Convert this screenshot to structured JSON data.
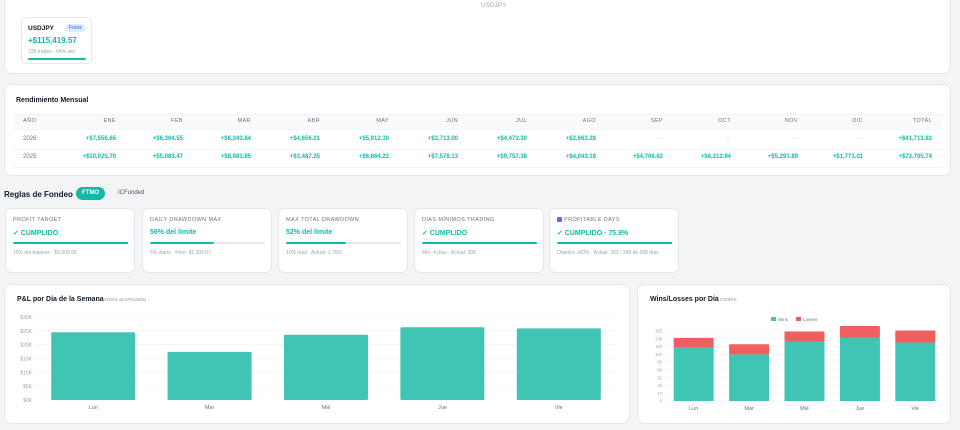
{
  "top": {
    "label": "USDJPY",
    "symbol": {
      "name": "USDJPY",
      "badge": "Forex",
      "value": "+$115,419.57",
      "sub": "729 trades · 64% win"
    }
  },
  "monthly": {
    "title": "Rendimiento Mensual",
    "headers": [
      "AÑO",
      "ENE",
      "FEB",
      "MAR",
      "ABR",
      "MAY",
      "JUN",
      "JUL",
      "AGO",
      "SEP",
      "OCT",
      "NOV",
      "DIC",
      "TOTAL"
    ],
    "rows": [
      {
        "year": "2026",
        "values": [
          "+$7,556.65",
          "+$6,304.55",
          "+$6,343.84",
          "+$4,656.01",
          "+$5,912.30",
          "+$3,713.00",
          "+$4,473.30",
          "+$2,663.28",
          "—",
          "—",
          "—",
          "—",
          "+$41,713.83"
        ]
      },
      {
        "year": "2025",
        "values": [
          "+$10,025.70",
          "+$5,083.47",
          "+$8,983.95",
          "+$3,487.25",
          "+$6,664.22",
          "+$7,578.13",
          "+$9,757.38",
          "+$4,043.18",
          "+$4,706.62",
          "+$6,312.94",
          "+$5,291.89",
          "+$1,771.01",
          "+$73,705.74"
        ]
      }
    ]
  },
  "reglas": {
    "title": "Reglas de Fondeo",
    "tabs": [
      "FTMO",
      "ICFunded"
    ],
    "cards": [
      {
        "title": "PROFIT TARGET",
        "status": "✓ CUMPLIDO",
        "progress": 100,
        "detail": "10% del balance · $5,000.00"
      },
      {
        "title": "DAILY DRAWDOWN MAX",
        "status": "56% del límite",
        "progress": 56,
        "detail": "5% diario · Peor: $1,393.67"
      },
      {
        "title": "MAX TOTAL DRAWDOWN",
        "status": "52% del límite",
        "progress": 52,
        "detail": "10% total · Actual: 1.76%"
      },
      {
        "title": "DÍAS MÍNIMOS TRADING",
        "status": "✓ CUMPLIDO",
        "progress": 100,
        "detail": "Mín. 4 días · Actual: 398"
      },
      {
        "title": "PROFITABLE DAYS",
        "status": "✓ CUMPLIDO · 75.9%",
        "progress": 100,
        "detail": "Objetivo ≥60% · Actual: 302 / 398 de 398 días"
      }
    ]
  },
  "pnl_chart": {
    "title": "P&L por Día de la Semana",
    "subtitle": "suma acumulada"
  },
  "wl_chart": {
    "title": "Wins/Losses por Día",
    "subtitle": "conteo"
  },
  "colors": {
    "accent": "#14b8a6",
    "bar": "#40c4b4",
    "loss": "#ef5f5f"
  },
  "chart_data": [
    {
      "type": "bar",
      "title": "P&L por Día de la Semana",
      "categories": [
        "Lun",
        "Mar",
        "Mié",
        "Jue",
        "Vie"
      ],
      "values": [
        24500,
        17400,
        23600,
        26300,
        25900
      ],
      "yticks": [
        "$0K",
        "$5K",
        "$10K",
        "$15K",
        "$20K",
        "$25K",
        "$30K"
      ],
      "ylim": [
        0,
        30000
      ],
      "grid": true
    },
    {
      "type": "bar",
      "title": "Wins/Losses por Día",
      "categories": [
        "Lun",
        "Mar",
        "Mié",
        "Jue",
        "Vie"
      ],
      "series": [
        {
          "name": "Wins",
          "values": [
            118,
            102,
            130,
            138,
            128
          ]
        },
        {
          "name": "Losses",
          "values": [
            20,
            22,
            22,
            26,
            26
          ]
        }
      ],
      "stacked": true,
      "yticks": [
        "0",
        "17",
        "34",
        "51",
        "68",
        "85",
        "102",
        "119",
        "136",
        "153"
      ],
      "ylim": [
        0,
        153
      ],
      "legend": "top-center"
    }
  ]
}
